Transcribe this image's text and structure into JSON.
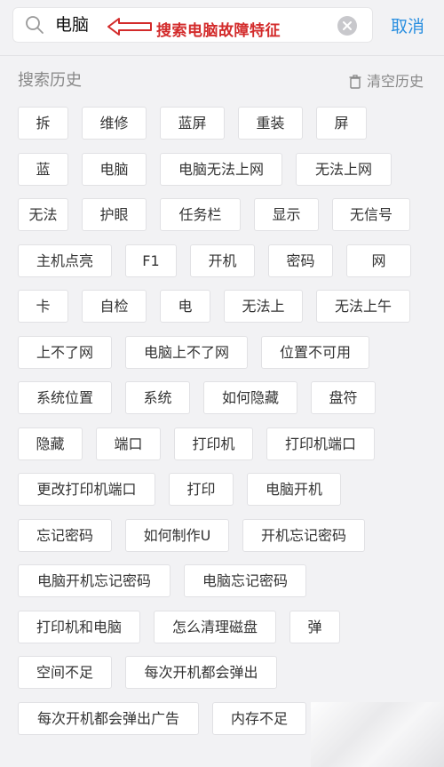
{
  "search": {
    "value": "电脑",
    "cancel_label": "取消"
  },
  "annotation": {
    "text": "搜索电脑故障特征",
    "color": "#d32b2b"
  },
  "history": {
    "title": "搜索历史",
    "clear_label": "清空历史"
  },
  "colors": {
    "accent": "#2a8fe0",
    "background": "#f2f2f4"
  },
  "tag_rows": [
    [
      "拆",
      "维修",
      "蓝屏",
      "重装",
      "屏"
    ],
    [
      "蓝",
      "电脑",
      "电脑无法上网",
      "无法上网"
    ],
    [
      "无法",
      "护眼",
      "任务栏",
      "显示",
      "无信号"
    ],
    [
      "主机点亮",
      "F1",
      "开机",
      "密码",
      "网"
    ],
    [
      "卡",
      "自检",
      "电",
      "无法上",
      "无法上午"
    ],
    [
      "上不了网",
      "电脑上不了网",
      "位置不可用"
    ],
    [
      "系统位置",
      "系统",
      "如何隐藏",
      "盘符"
    ],
    [
      "隐藏",
      "端口",
      "打印机",
      "打印机端口"
    ],
    [
      "更改打印机端口",
      "打印",
      "电脑开机"
    ],
    [
      "忘记密码",
      "如何制作U",
      "开机忘记密码"
    ],
    [
      "电脑开机忘记密码",
      "电脑忘记密码"
    ],
    [
      "打印机和电脑",
      "怎么清理磁盘",
      "弹"
    ],
    [
      "空间不足",
      "每次开机都会弹出"
    ],
    [
      "每次开机都会弹出广告",
      "内存不足"
    ]
  ]
}
